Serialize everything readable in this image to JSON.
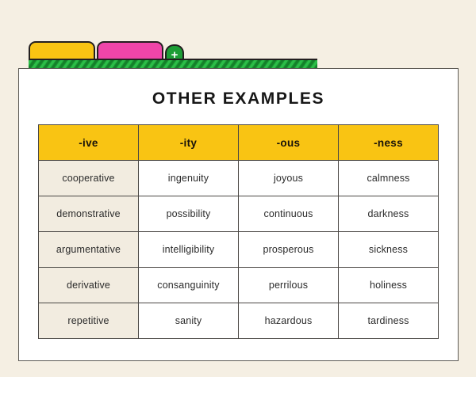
{
  "colors": {
    "page_background": "#f5efe3",
    "card_background": "#ffffff",
    "tab_yellow": "#f9c413",
    "tab_pink": "#ef45a9",
    "add_button_green": "#1c9d35",
    "shelf_green": "#1c9d35",
    "header_amber": "#f9c413",
    "first_column_cream": "#f2ece0",
    "outline_dark": "#231f20"
  },
  "tabs": [
    {
      "name": "tab-yellow",
      "label": "",
      "color": "#f9c413"
    },
    {
      "name": "tab-pink",
      "label": "",
      "color": "#ef45a9"
    }
  ],
  "add_tab_button": {
    "icon": "plus-icon",
    "glyph": "+"
  },
  "card": {
    "title": "OTHER EXAMPLES"
  },
  "table": {
    "headers": [
      "-ive",
      "-ity",
      "-ous",
      "-ness"
    ],
    "rows": [
      [
        "cooperative",
        "ingenuity",
        "joyous",
        "calmness"
      ],
      [
        "demonstrative",
        "possibility",
        "continuous",
        "darkness"
      ],
      [
        "argumentative",
        "intelligibility",
        "prosperous",
        "sickness"
      ],
      [
        "derivative",
        "consanguinity",
        "perrilous",
        "holiness"
      ],
      [
        "repetitive",
        "sanity",
        "hazardous",
        "tardiness"
      ]
    ]
  }
}
